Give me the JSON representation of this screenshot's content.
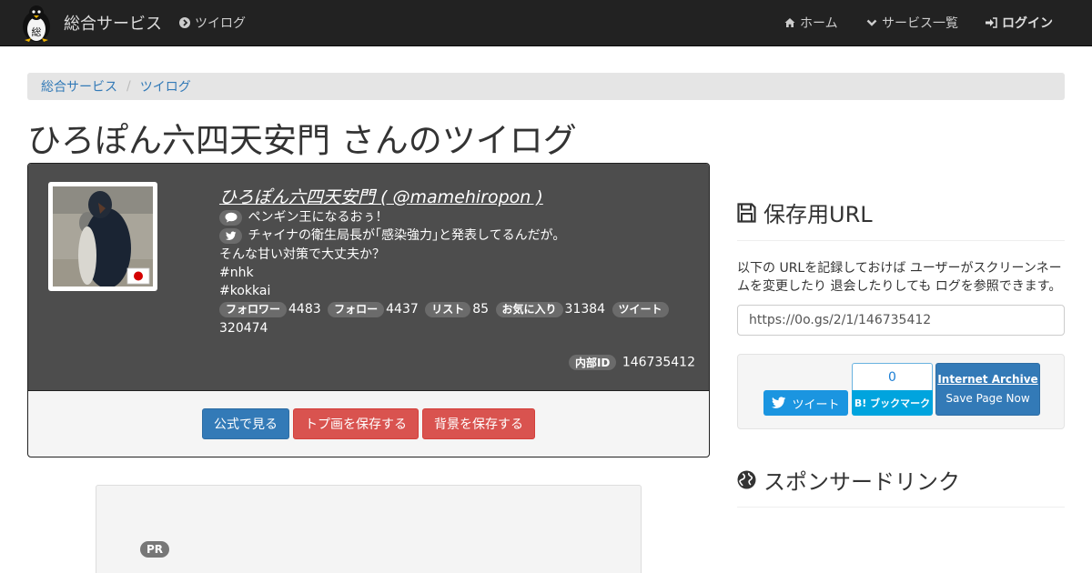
{
  "navbar": {
    "brand": "総合サービス",
    "tsuilog_link": "ツイログ",
    "home_link": "ホーム",
    "services_link": "サービス一覧",
    "login_link": "ログイン",
    "logo_char": "総"
  },
  "breadcrumb": {
    "items": [
      "総合サービス",
      "ツイログ"
    ],
    "separator": "/"
  },
  "page_title": "ひろぽん六四天安門 さんのツイログ",
  "profile": {
    "name_line": "ひろぽん六四天安門 ( @mamehiropon )",
    "bio_line1": "ペンギン王になるおぅ！",
    "bio_line2": "チャイナの衛生局長が｢感染強力｣と発表してるんだが。",
    "bio_line3": "そんな甘い対策で大丈夫か？",
    "bio_line4": "#nhk",
    "bio_line5": "#kokkai",
    "stats": {
      "followers_label": "フォロワー",
      "followers": "4483",
      "following_label": "フォロー",
      "following": "4437",
      "lists_label": "リスト",
      "lists": "85",
      "favorites_label": "お気に入り",
      "favorites": "31384",
      "tweets_label": "ツイート",
      "tweets": "320474"
    },
    "internal_id_label": "内部ID",
    "internal_id": "146735412"
  },
  "actions": {
    "view_official": "公式で見る",
    "save_avatar": "トプ画を保存する",
    "save_background": "背景を保存する"
  },
  "ad": {
    "badge": "PR"
  },
  "save_url": {
    "heading": "保存用URL",
    "description": "以下の URLを記録しておけば ユーザーがスクリーンネームを変更したり 退会したりしても ログを参照できます。",
    "url": "https://0o.gs/2/1/146735412"
  },
  "share": {
    "tweet_label": "ツイート",
    "hatena_count": "0",
    "hatena_label": "B! ブックマーク",
    "archive_title": "Internet Archive",
    "archive_sub": "Save Page Now"
  },
  "sponsored": {
    "heading": "スポンサードリンク"
  },
  "colors": {
    "navbar_bg": "#222222",
    "profile_bg": "#4d4d4d",
    "primary": "#337ab7",
    "danger": "#d9534f",
    "twitter": "#1b95e0",
    "hatena": "#00a4de"
  }
}
